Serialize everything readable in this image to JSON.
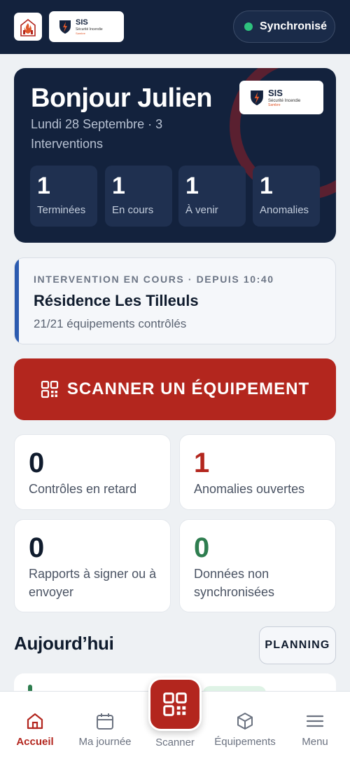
{
  "header": {
    "brand": {
      "name": "SIS",
      "tagline": "Sécurité Incendie",
      "subtag": "Sambre"
    },
    "sync_status": "Synchronisé",
    "colors": {
      "bar": "#13223d",
      "sync_dot": "#2ec27e"
    }
  },
  "hero": {
    "greeting": "Bonjour Julien",
    "subtitle": "Lundi 28 Septembre · 3 Interventions",
    "logo": {
      "name": "SIS",
      "tagline": "Sécurité Incendie",
      "subtag": "Sambre"
    },
    "stats": [
      {
        "value": "1",
        "label": "Terminées"
      },
      {
        "value": "1",
        "label": "En cours"
      },
      {
        "value": "1",
        "label": "À venir"
      },
      {
        "value": "1",
        "label": "Anomalies"
      }
    ]
  },
  "current": {
    "kicker": "INTERVENTION EN COURS · DEPUIS 10:40",
    "title": "Résidence Les Tilleuls",
    "detail": "21/21 équipements contrôlés"
  },
  "scan": {
    "label": "SCANNER UN ÉQUIPEMENT",
    "color": "#b3261e"
  },
  "kpis": [
    {
      "value": "0",
      "label": "Contrôles en retard",
      "color": "#0f1b2d"
    },
    {
      "value": "1",
      "label": "Anomalies ouvertes",
      "color": "#b3261e"
    },
    {
      "value": "0",
      "label": "Rapports à signer ou à envoyer",
      "color": "#0f1b2d"
    },
    {
      "value": "0",
      "label": "Données non synchronisées",
      "color": "#2e7d4f"
    }
  ],
  "today": {
    "title": "Aujourd’hui",
    "planning_label": "PLANNING"
  },
  "nav": {
    "items": [
      {
        "label": "Accueil",
        "icon": "home-icon",
        "active": true
      },
      {
        "label": "Ma journée",
        "icon": "calendar-icon"
      },
      {
        "label": "Scanner",
        "icon": "qr-scan-icon"
      },
      {
        "label": "Équipements",
        "icon": "box-icon"
      },
      {
        "label": "Menu",
        "icon": "menu-icon"
      }
    ]
  }
}
